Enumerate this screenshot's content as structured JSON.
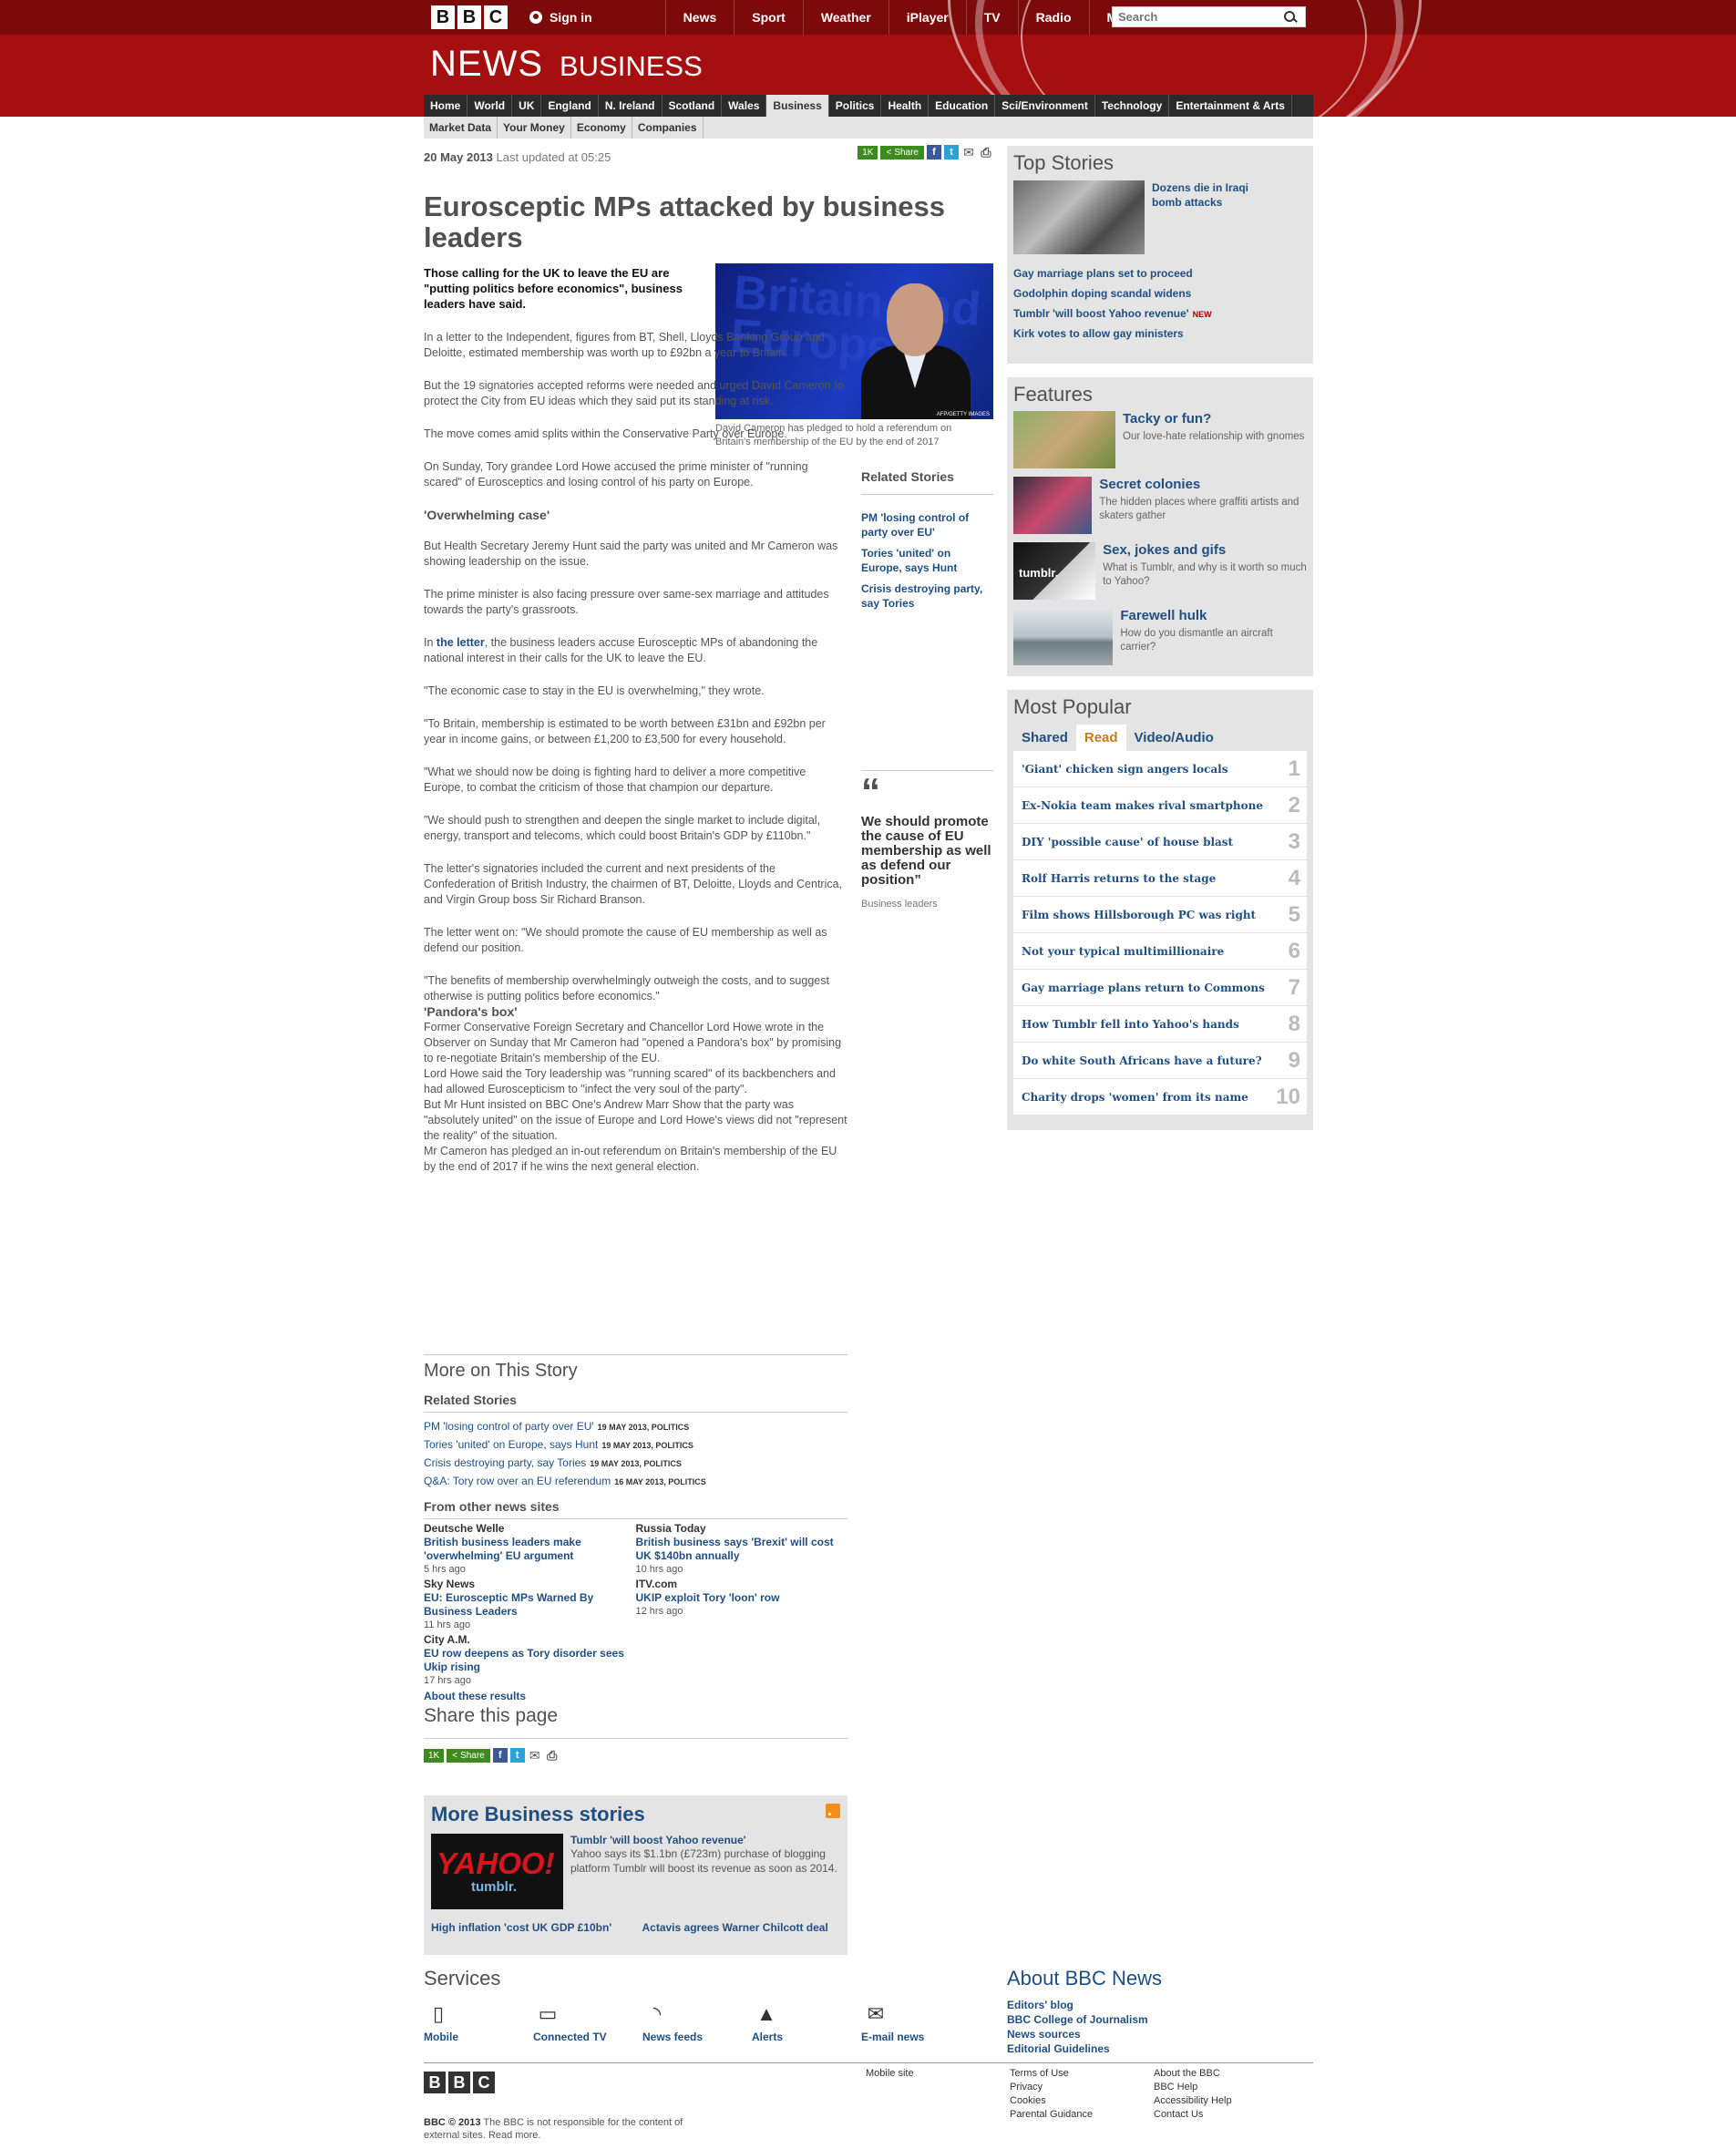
{
  "header": {
    "bbc_letters": [
      "B",
      "B",
      "C"
    ],
    "sign_in": "Sign in",
    "topnav": [
      "News",
      "Sport",
      "Weather",
      "iPlayer",
      "TV",
      "Radio",
      "More…"
    ],
    "search_placeholder": "Search",
    "brand": "NEWS",
    "section": "BUSINESS"
  },
  "nav": {
    "items": [
      "Home",
      "World",
      "UK",
      "England",
      "N. Ireland",
      "Scotland",
      "Wales",
      "Business",
      "Politics",
      "Health",
      "Education",
      "Sci/Environment",
      "Technology",
      "Entertainment & Arts"
    ],
    "active": "Business",
    "sub": [
      "Market Data",
      "Your Money",
      "Economy",
      "Companies"
    ]
  },
  "article": {
    "date": "20 May 2013",
    "updated": "Last updated at 05:25",
    "share_count": "1K",
    "share_label": "Share",
    "headline": "Eurosceptic MPs attacked by business leaders",
    "intro": "Those calling for the UK to leave the EU are \"putting politics before economics\", business leaders have said.",
    "photo_text": "Britain and Europe",
    "photo_credit": "AFP/GETTY IMAGES",
    "caption": "David Cameron has pledged to hold a referendum on Britain's membership of the EU by the end of 2017",
    "p1": "In a letter to the Independent, figures from BT, Shell, Lloyds Banking Group and Deloitte, estimated membership was worth up to £92bn a year to Britain.",
    "p2": "But the 19 signatories accepted reforms were needed and urged David Cameron to protect the City from EU ideas which they said put its standing at risk.",
    "p3": "The move comes amid splits within the Conservative Party over Europe.",
    "p4": "On Sunday, Tory grandee Lord Howe accused the prime minister of \"running scared\" of Eurosceptics and losing control of his party on Europe.",
    "h1": "'Overwhelming case'",
    "p5": "But Health Secretary Jeremy Hunt said the party was united and Mr Cameron was showing leadership on the issue.",
    "p6": "The prime minister is also facing pressure over same-sex marriage and attitudes towards the party's grassroots.",
    "p7_pre": "In",
    "p7_link": "the letter",
    "p7_post": ", the business leaders accuse Eurosceptic MPs of abandoning the national interest in their calls for the UK to leave the EU.",
    "p8": "\"The economic case to stay in the EU is overwhelming,\" they wrote.",
    "p9": "\"To Britain, membership is estimated to be worth between £31bn and £92bn per year in income gains, or between £1,200 to £3,500 for every household.",
    "p10": "\"What we should now be doing is fighting hard to deliver a more competitive Europe, to combat the criticism of those that champion our departure.",
    "p11": "\"We should push to strengthen and deepen the single market to include digital, energy, transport and telecoms, which could boost Britain's GDP by £110bn.\"",
    "p12": "The letter's signatories included the current and next presidents of the Confederation of British Industry, the chairmen of BT, Deloitte, Lloyds and Centrica, and Virgin Group boss Sir Richard Branson.",
    "p13": "The letter went on: \"We should promote the cause of EU membership as well as defend our position.",
    "p14": "\"The benefits of membership overwhelmingly outweigh the costs, and to suggest otherwise is putting politics before economics.\"",
    "h2": "'Pandora's box'",
    "p15": "Former Conservative Foreign Secretary and Chancellor Lord Howe wrote in the Observer on Sunday that Mr Cameron had \"opened a Pandora's box\" by promising to re-negotiate Britain's membership of the EU.",
    "p16": "Lord Howe said the Tory leadership was \"running scared\" of its backbenchers and had allowed Euroscepticism to \"infect the very soul of the party\".",
    "p17": "But Mr Hunt insisted on BBC One's Andrew Marr Show that the party was \"absolutely united\" on the issue of Europe and Lord Howe's views did not \"represent the reality\" of the situation.",
    "p18": "Mr Cameron has pledged an in-out referendum on Britain's membership of the EU by the end of 2017 if he wins the next general election.",
    "related_title": "Related Stories",
    "related": [
      "PM 'losing control of party over EU'",
      "Tories 'united' on Europe, says Hunt",
      "Crisis destroying party, say Tories"
    ],
    "quote_mark": "“",
    "quote": "We should promote the cause of EU membership as well as defend our position”",
    "quote_source": "Business leaders"
  },
  "more": {
    "title": "More on This Story",
    "related_title": "Related Stories",
    "links": [
      {
        "text": "PM 'losing control of party over EU'",
        "date": "19 MAY 2013",
        "section": "POLITICS"
      },
      {
        "text": "Tories 'united' on Europe, says Hunt",
        "date": "19 MAY 2013",
        "section": "POLITICS"
      },
      {
        "text": "Crisis destroying party, say Tories",
        "date": "19 MAY 2013",
        "section": "POLITICS"
      },
      {
        "text": "Q&A: Tory row over an EU referendum",
        "date": "16 MAY 2013",
        "section": "POLITICS"
      }
    ],
    "other_title": "From other news sites",
    "left": [
      {
        "source": "Deutsche Welle",
        "link": "British business leaders make 'overwhelming' EU argument",
        "ago": "5 hrs ago"
      },
      {
        "source": "Sky News",
        "link": "EU: Eurosceptic MPs Warned By Business Leaders",
        "ago": "11 hrs ago"
      },
      {
        "source": "City A.M.",
        "link": "EU row deepens as Tory disorder sees Ukip rising",
        "ago": "17 hrs ago"
      }
    ],
    "right": [
      {
        "source": "Russia Today",
        "link": "British business says 'Brexit' will cost UK $140bn annually",
        "ago": "10 hrs ago"
      },
      {
        "source": "ITV.com",
        "link": "UKIP exploit Tory 'loon' row",
        "ago": "12 hrs ago"
      }
    ],
    "about": "About these results",
    "share_title": "Share this page"
  },
  "business": {
    "title": "More Business stories",
    "feat_link": "Tumblr 'will boost Yahoo revenue'",
    "feat_text": "Yahoo says its $1.1bn (£723m) purchase of blogging platform Tumblr will boost its revenue as soon as 2014.",
    "logo1": "YAHOO!",
    "logo2": "tumblr.",
    "link2": "High inflation 'cost UK GDP £10bn'",
    "link3": "Actavis agrees Warner Chilcott deal"
  },
  "sidebar": {
    "top_title": "Top Stories",
    "top_lead": "Dozens die in Iraqi bomb attacks",
    "top_items": [
      "Gay marriage plans set to proceed",
      "Godolphin doping scandal widens",
      "Tumblr 'will boost Yahoo revenue'",
      "Kirk votes to allow gay ministers"
    ],
    "new_badge": "NEW",
    "features_title": "Features",
    "features": [
      {
        "title": "Tacky or fun?",
        "text": "Our love-hate relationship with gnomes"
      },
      {
        "title": "Secret colonies",
        "text": "The hidden places where graffiti artists and skaters gather"
      },
      {
        "title": "Sex, jokes and gifs",
        "text": "What is Tumblr, and why is it worth so much to Yahoo?"
      },
      {
        "title": "Farewell hulk",
        "text": "How do you dismantle an aircraft carrier?"
      }
    ],
    "tumblr_thumb": "tumblr.",
    "popular_title": "Most Popular",
    "tabs": [
      "Shared",
      "Read",
      "Video/Audio"
    ],
    "active_tab": "Read",
    "popular": [
      "'Giant' chicken sign angers locals",
      "Ex-Nokia team makes rival smartphone",
      "DIY 'possible cause' of house blast",
      "Rolf Harris returns to the stage",
      "Film shows Hillsborough PC was right",
      "Not your typical multimillionaire",
      "Gay marriage plans return to Commons",
      "How Tumblr fell into Yahoo's hands",
      "Do white South Africans have a future?",
      "Charity drops 'women' from its name"
    ]
  },
  "footer": {
    "services_title": "Services",
    "services": [
      "Mobile",
      "Connected TV",
      "News feeds",
      "Alerts",
      "E-mail news"
    ],
    "about_title": "About BBC News",
    "about_links": [
      "Editors' blog",
      "BBC College of Journalism",
      "News sources",
      "Editorial Guidelines"
    ],
    "mobile_site": "Mobile site",
    "col1": [
      "Terms of Use",
      "Privacy",
      "Cookies",
      "Parental Guidance"
    ],
    "col2": [
      "About the BBC",
      "BBC Help",
      "Accessibility Help",
      "Contact Us"
    ],
    "copyright": "BBC © 2013",
    "disclaimer": "The BBC is not responsible for the content of external sites.",
    "read_more": "Read more."
  }
}
